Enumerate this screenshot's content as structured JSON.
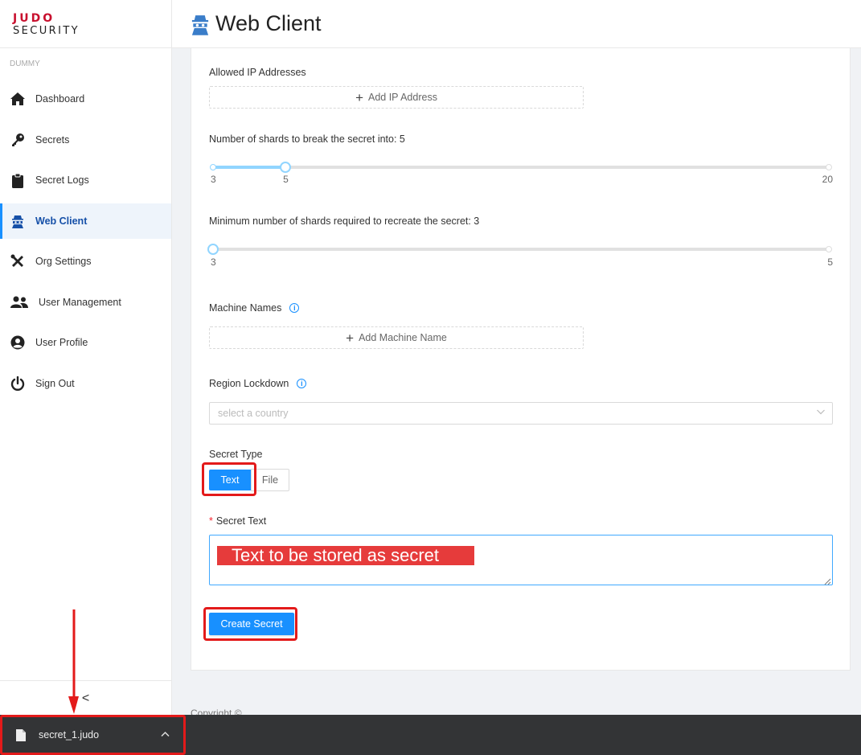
{
  "brand": {
    "line1": "JUDO",
    "line2": "SECURITY"
  },
  "sidebar": {
    "org": "DUMMY",
    "items": [
      {
        "label": "Dashboard",
        "icon": "home-icon"
      },
      {
        "label": "Secrets",
        "icon": "key-icon"
      },
      {
        "label": "Secret Logs",
        "icon": "clipboard-icon"
      },
      {
        "label": "Web Client",
        "icon": "spy-icon",
        "active": true
      },
      {
        "label": "Org Settings",
        "icon": "tools-icon"
      },
      {
        "label": "User Management",
        "icon": "users-icon"
      },
      {
        "label": "User Profile",
        "icon": "user-circle-icon"
      },
      {
        "label": "Sign Out",
        "icon": "power-icon"
      }
    ],
    "collapse": "<"
  },
  "header": {
    "title": "Web Client",
    "icon": "spy-icon"
  },
  "form": {
    "allowed_ip": {
      "label": "Allowed IP Addresses",
      "button": "Add IP Address"
    },
    "shards": {
      "label": "Number of shards to break the secret into: 5",
      "min": 3,
      "max": 20,
      "value": 5,
      "tick_min": "3",
      "tick_value": "5",
      "tick_max": "20"
    },
    "min_shards": {
      "label": "Minimum number of shards required to recreate the secret: 3",
      "min": 3,
      "max": 5,
      "value": 3,
      "tick_min": "3",
      "tick_max": "5"
    },
    "machine_names": {
      "label": "Machine Names",
      "button": "Add Machine Name"
    },
    "region": {
      "label": "Region Lockdown",
      "placeholder": "select a country"
    },
    "secret_type": {
      "label": "Secret Type",
      "options": [
        "Text",
        "File"
      ],
      "selected": "Text"
    },
    "secret_text": {
      "required_mark": "*",
      "label": "Secret Text",
      "value": ""
    },
    "create_button": "Create Secret"
  },
  "annotation": {
    "overlay_text": "Text to be stored as secret",
    "color": "#e31a1a"
  },
  "footer": {
    "copyright": "Copyright ©"
  },
  "download_bar": {
    "filename": "secret_1.judo"
  },
  "colors": {
    "primary": "#1890ff",
    "active_nav": "#1650a8",
    "brand_red": "#c8102e"
  }
}
